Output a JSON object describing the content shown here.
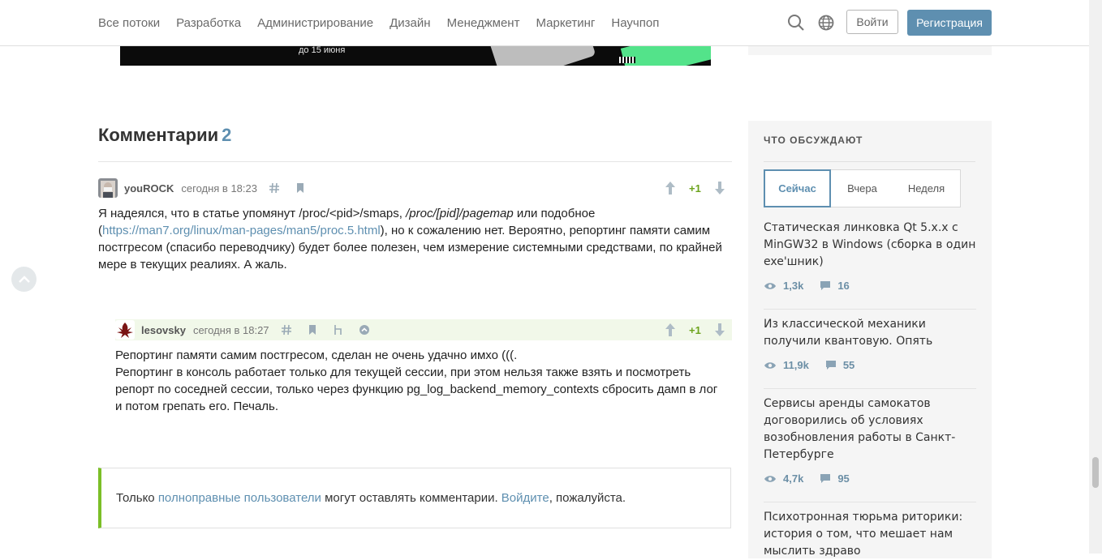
{
  "nav": [
    "Все потоки",
    "Разработка",
    "Администрирование",
    "Дизайн",
    "Менеджмент",
    "Маркетинг",
    "Научпоп"
  ],
  "header": {
    "login": "Войти",
    "register": "Регистрация",
    "accent": "#5e8fb0"
  },
  "banner": {
    "text": "до 15 июня"
  },
  "comments": {
    "title": "Комментарии",
    "count": "2",
    "items": [
      {
        "user": "youROCK",
        "time": "сегодня в 18:23",
        "score": "+1",
        "text_1": "Я надеялся, что в статье упомянут /proc/<pid>/smaps, ",
        "text_italic": "/proc/[pid]/pagemap",
        "text_2": " или подобное (",
        "link": "https://man7.org/linux/man-pages/man5/proc.5.html",
        "text_3": "), но к сожалению нет. Вероятно, репортинг памяти самим постгресом (спасибо переводчику) будет более полезен, чем измерение системными средствами, по крайней мере в текущих реалиях. А жаль."
      },
      {
        "user": "lesovsky",
        "time": "сегодня в 18:27",
        "score": "+1",
        "line_1": "Репортинг памяти самим постгресом, сделан не очень удачно имхо (((.",
        "line_2": "Репортинг в консоль работает только для текущей сессии, при этом нельзя также взять и посмотреть репорт по соседней сессии, только через функцию pg_log_backend_memory_contexts сбросить дамп в лог и потом грепать его. Печаль."
      }
    ],
    "notice": {
      "pre": "Только ",
      "link1": "полноправные пользователи",
      "mid": " могут оставлять комментарии. ",
      "link2": "Войдите",
      "post": ", пожалуйста."
    }
  },
  "sidebar": {
    "title": "ЧТО ОБСУЖДАЮТ",
    "tabs": [
      "Сейчас",
      "Вчера",
      "Неделя"
    ],
    "articles": [
      {
        "title": "Статическая линковка Qt 5.x.x с MinGW32 в Windows (сборка в один exe'шник)",
        "views": "1,3k",
        "comments": "16"
      },
      {
        "title": "Из классической механики получили квантовую. Опять",
        "views": "11,9k",
        "comments": "55"
      },
      {
        "title": "Сервисы аренды самокатов договорились об условиях возобновления работы в Санкт-Петербурге",
        "views": "4,7k",
        "comments": "95"
      },
      {
        "title": "Психотронная тюрьма риторики: история о том, что мешает нам мыслить здраво"
      }
    ]
  }
}
